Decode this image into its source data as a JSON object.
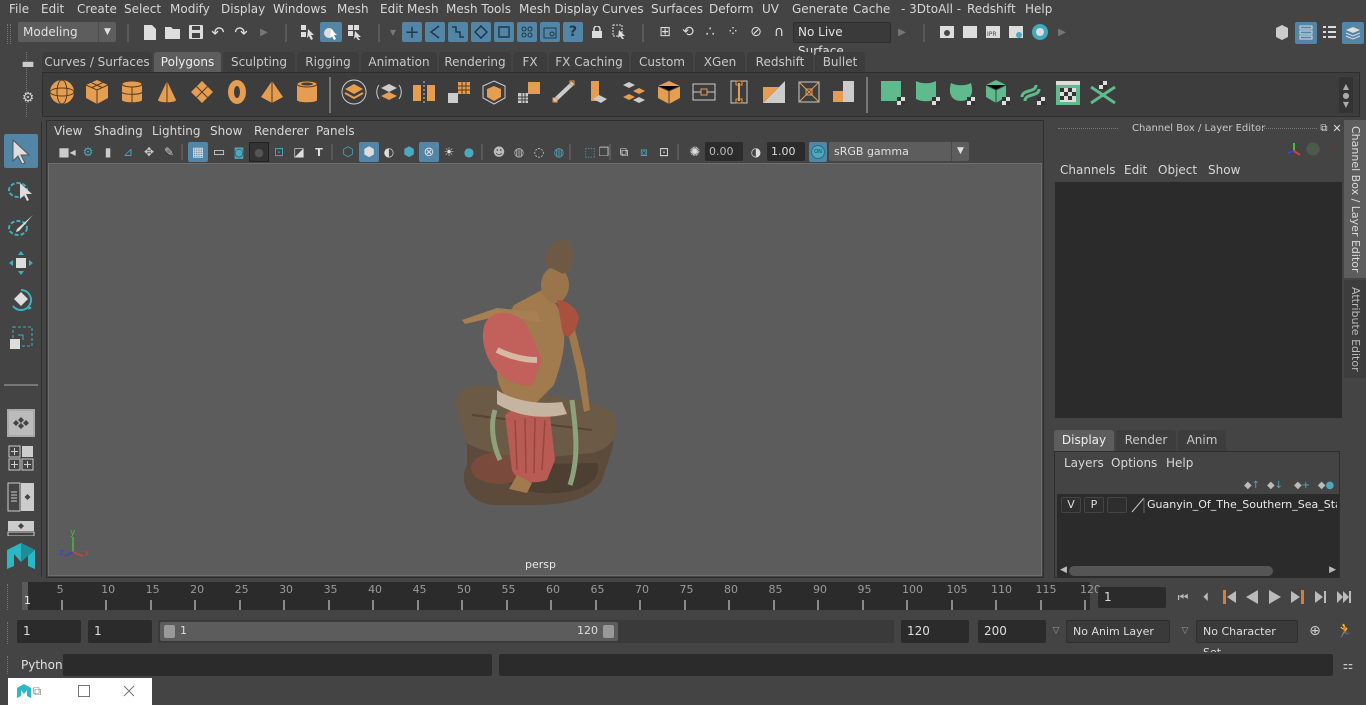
{
  "menubar": {
    "items": [
      "File",
      "Edit",
      "Create",
      "Select",
      "Modify",
      "Display",
      "Windows",
      "Mesh",
      "Edit Mesh",
      "Mesh Tools",
      "Mesh Display",
      "Curves",
      "Surfaces",
      "Deform",
      "UV",
      "Generate",
      "Cache",
      "- 3DtoAll -",
      "Redshift",
      "Help"
    ]
  },
  "statusline": {
    "workspace": "Modeling",
    "live_surface": "No Live Surface"
  },
  "shelf": {
    "tabs": [
      "Curves / Surfaces",
      "Polygons",
      "Sculpting",
      "Rigging",
      "Animation",
      "Rendering",
      "FX",
      "FX Caching",
      "Custom",
      "XGen",
      "Redshift",
      "Bullet"
    ],
    "active_tab": "Polygons",
    "icons": [
      "poly-sphere-icon",
      "poly-cube-icon",
      "poly-cylinder-icon",
      "poly-cone-icon",
      "poly-plane-icon",
      "poly-torus-icon",
      "poly-pyramid-icon",
      "poly-pipe-icon",
      "combine-icon",
      "separate-icon",
      "mirror-icon",
      "smooth-icon",
      "bevel-icon",
      "bridge-icon",
      "extrude-icon",
      "multi-cut-icon",
      "insert-edge-loop-icon",
      "merge-vertices-icon",
      "edge-flow-icon",
      "fill-hole-icon",
      "target-weld-icon",
      "planar-uv-icon",
      "cylindrical-uv-icon",
      "spherical-uv-icon",
      "automatic-uv-icon",
      "unfold-uv-icon",
      "uv-editor-icon",
      "layout-uv-icon"
    ]
  },
  "viewport": {
    "menu": [
      "View",
      "Shading",
      "Lighting",
      "Show",
      "Renderer",
      "Panels"
    ],
    "exposure": "0.00",
    "gamma": "1.00",
    "color_mgmt_on": "ON",
    "color_space": "sRGB gamma",
    "camera_label": "persp",
    "object": "Guanyin of the Southern Sea statue model",
    "axis": {
      "x": "x",
      "y": "y",
      "z": "z"
    }
  },
  "channel_box": {
    "title": "Channel Box / Layer Editor",
    "menu": [
      "Channels",
      "Edit",
      "Object",
      "Show"
    ]
  },
  "layer_editor": {
    "tabs": [
      "Display",
      "Render",
      "Anim"
    ],
    "active_tab": "Display",
    "menu": [
      "Layers",
      "Options",
      "Help"
    ],
    "layers": [
      {
        "visible": "V",
        "playback": "P",
        "type": "",
        "name": "Guanyin_Of_The_Southern_Sea_Statue"
      }
    ]
  },
  "side_tabs": [
    "Channel Box / Layer Editor",
    "Attribute Editor"
  ],
  "timeline": {
    "ticks": [
      5,
      10,
      15,
      20,
      25,
      30,
      35,
      40,
      45,
      50,
      55,
      60,
      65,
      70,
      75,
      80,
      85,
      90,
      95,
      100,
      105,
      110,
      115,
      120
    ],
    "min": 1,
    "max": 120,
    "current_frame": "1",
    "current_frame_field": "1"
  },
  "range": {
    "start": "1",
    "playback_start": "1",
    "slider_start": "1",
    "slider_end": "120",
    "playback_end": "120",
    "end": "200",
    "anim_layer": "No Anim Layer",
    "character_set": "No Character Set"
  },
  "cmdline": {
    "language": "Python",
    "input": "",
    "output": ""
  }
}
